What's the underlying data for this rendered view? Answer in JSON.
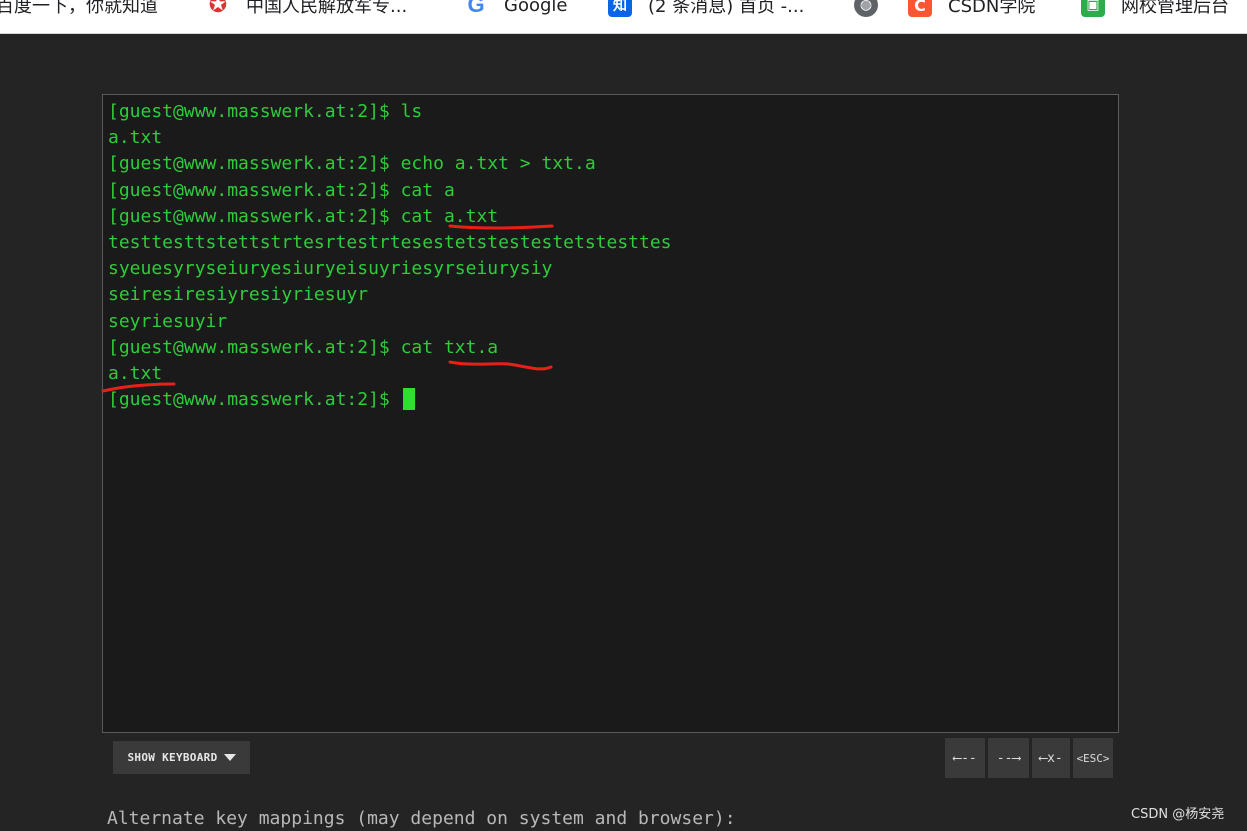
{
  "bookmarks": [
    {
      "icon": "",
      "label": "百度一下，你就知道"
    },
    {
      "icon": "army-star-icon",
      "label": "中国人民解放军专..."
    },
    {
      "icon": "google-icon",
      "label": "Google"
    },
    {
      "icon": "zhihu-icon",
      "label": "(2 条消息) 首页 -..."
    },
    {
      "icon": "globe-icon",
      "label": ""
    },
    {
      "icon": "csdn-icon",
      "label": "CSDN学院"
    },
    {
      "icon": "school-icon",
      "label": "网校管理后台"
    }
  ],
  "terminal": {
    "lines": [
      "[guest@www.masswerk.at:2]$ ls",
      "a.txt",
      "[guest@www.masswerk.at:2]$ echo a.txt > txt.a",
      "[guest@www.masswerk.at:2]$ cat a",
      "[guest@www.masswerk.at:2]$ cat a.txt",
      "testtesttstettstrtesrtestrtesestetstestestetstesttes",
      "syeuesyryseiuryesiuryeisuyriesyrseiurysiy",
      "seiresiresiyresiyriesuyr",
      "seyriesuyir",
      "[guest@www.masswerk.at:2]$ cat txt.a",
      "a.txt"
    ],
    "prompt": "[guest@www.masswerk.at:2]$ ",
    "text_color": "#2ecc3a",
    "annotation_color": "#e8201a"
  },
  "controls": {
    "show_keyboard": "SHOW KEYBOARD",
    "keys": [
      "⟵--",
      "--⟶",
      "⟵x-",
      "<ESC>"
    ]
  },
  "footer": {
    "alternate_text": "Alternate key mappings (may depend on system and browser):",
    "watermark": "CSDN @杨安尧"
  }
}
